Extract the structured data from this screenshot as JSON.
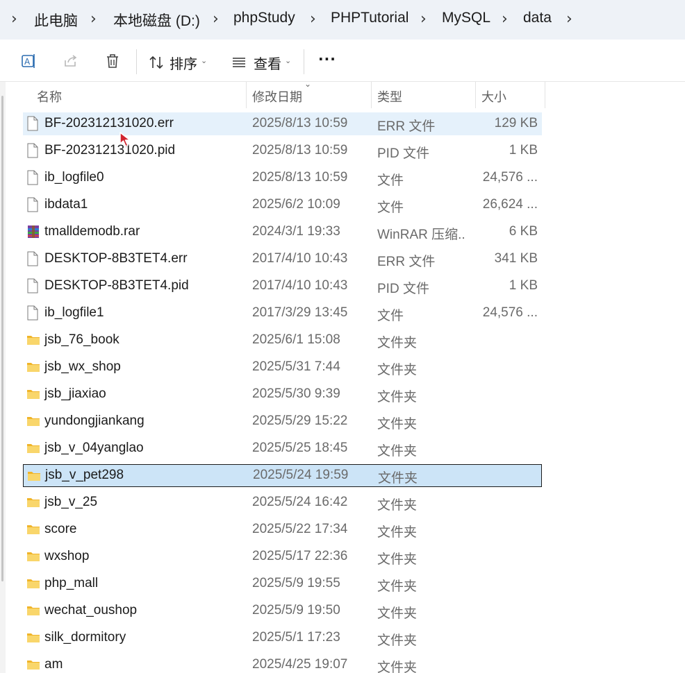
{
  "breadcrumb": {
    "items": [
      "此电脑",
      "本地磁盘 (D:)",
      "phpStudy",
      "PHPTutorial",
      "MySQL",
      "data"
    ]
  },
  "toolbar": {
    "sort_label": "排序",
    "view_label": "查看",
    "more_label": "···"
  },
  "columns": {
    "name": "名称",
    "date": "修改日期",
    "type": "类型",
    "size": "大小"
  },
  "files": [
    {
      "name": "BF-202312131020.err",
      "date": "2025/8/13 10:59",
      "type": "ERR 文件",
      "size": "129 KB",
      "icon": "file"
    },
    {
      "name": "BF-202312131020.pid",
      "date": "2025/8/13 10:59",
      "type": "PID 文件",
      "size": "1 KB",
      "icon": "file"
    },
    {
      "name": "ib_logfile0",
      "date": "2025/8/13 10:59",
      "type": "文件",
      "size": "24,576 ...",
      "icon": "file"
    },
    {
      "name": "ibdata1",
      "date": "2025/6/2 10:09",
      "type": "文件",
      "size": "26,624 ...",
      "icon": "file"
    },
    {
      "name": "tmalldemodb.rar",
      "date": "2024/3/1 19:33",
      "type": "WinRAR 压缩...",
      "size": "6 KB",
      "icon": "rar"
    },
    {
      "name": "DESKTOP-8B3TET4.err",
      "date": "2017/4/10 10:43",
      "type": "ERR 文件",
      "size": "341 KB",
      "icon": "file"
    },
    {
      "name": "DESKTOP-8B3TET4.pid",
      "date": "2017/4/10 10:43",
      "type": "PID 文件",
      "size": "1 KB",
      "icon": "file"
    },
    {
      "name": "ib_logfile1",
      "date": "2017/3/29 13:45",
      "type": "文件",
      "size": "24,576 ...",
      "icon": "file"
    },
    {
      "name": "jsb_76_book",
      "date": "2025/6/1 15:08",
      "type": "文件夹",
      "size": "",
      "icon": "folder"
    },
    {
      "name": "jsb_wx_shop",
      "date": "2025/5/31 7:44",
      "type": "文件夹",
      "size": "",
      "icon": "folder"
    },
    {
      "name": "jsb_jiaxiao",
      "date": "2025/5/30 9:39",
      "type": "文件夹",
      "size": "",
      "icon": "folder"
    },
    {
      "name": "yundongjiankang",
      "date": "2025/5/29 15:22",
      "type": "文件夹",
      "size": "",
      "icon": "folder"
    },
    {
      "name": "jsb_v_04yanglao",
      "date": "2025/5/25 18:45",
      "type": "文件夹",
      "size": "",
      "icon": "folder"
    },
    {
      "name": "jsb_v_pet298",
      "date": "2025/5/24 19:59",
      "type": "文件夹",
      "size": "",
      "icon": "folder"
    },
    {
      "name": "jsb_v_25",
      "date": "2025/5/24 16:42",
      "type": "文件夹",
      "size": "",
      "icon": "folder"
    },
    {
      "name": "score",
      "date": "2025/5/22 17:34",
      "type": "文件夹",
      "size": "",
      "icon": "folder"
    },
    {
      "name": "wxshop",
      "date": "2025/5/17 22:36",
      "type": "文件夹",
      "size": "",
      "icon": "folder"
    },
    {
      "name": "php_mall",
      "date": "2025/5/9 19:55",
      "type": "文件夹",
      "size": "",
      "icon": "folder"
    },
    {
      "name": "wechat_oushop",
      "date": "2025/5/9 19:50",
      "type": "文件夹",
      "size": "",
      "icon": "folder"
    },
    {
      "name": "silk_dormitory",
      "date": "2025/5/1 17:23",
      "type": "文件夹",
      "size": "",
      "icon": "folder"
    },
    {
      "name": "am",
      "date": "2025/4/25 19:07",
      "type": "文件夹",
      "size": "",
      "icon": "folder"
    }
  ],
  "selected_file": "jsb_v_pet298",
  "hovered_file": "BF-202312131020.err",
  "colors": {
    "hover": "#e5f1fb",
    "selected": "#cce4f7",
    "folder": "#f5c242",
    "cursor": "#d1242f"
  }
}
